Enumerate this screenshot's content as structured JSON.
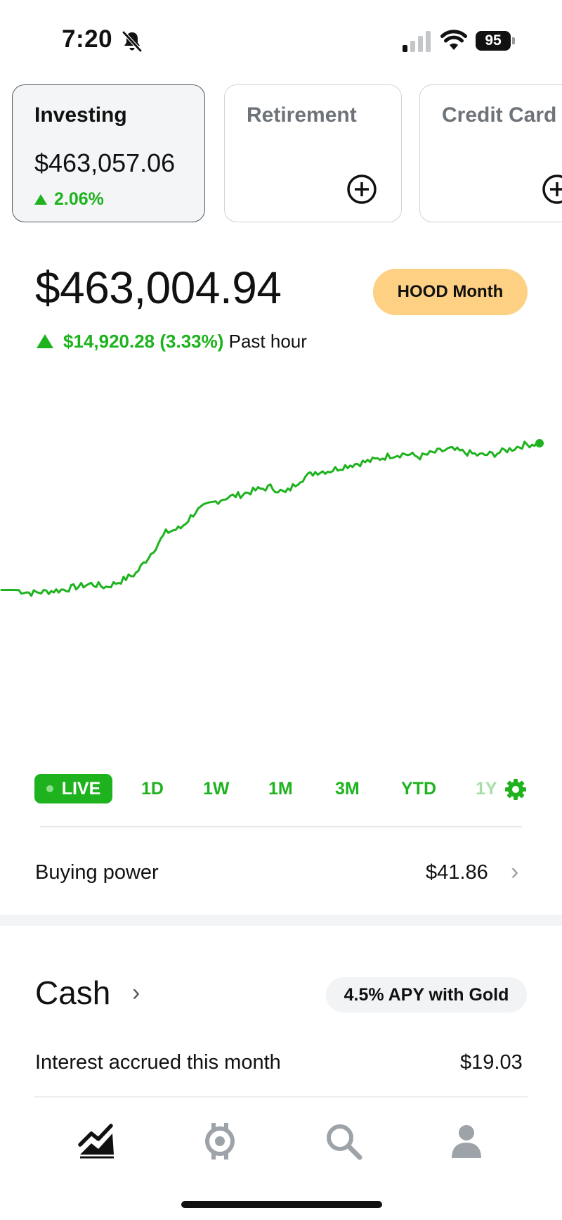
{
  "status_bar": {
    "time": "7:20",
    "battery": "95"
  },
  "accounts": [
    {
      "name": "Investing",
      "value": "$463,057.06",
      "change": "2.06%"
    },
    {
      "name": "Retirement"
    },
    {
      "name": "Credit Card"
    }
  ],
  "portfolio": {
    "value": "$463,004.94",
    "change_amount": "$14,920.28 (3.33%)",
    "change_period": "Past hour",
    "promo_label": "HOOD Month"
  },
  "chart_data": {
    "type": "line",
    "x_axis": "time (past hour)",
    "series": [
      {
        "values": [
          51.5,
          51.5,
          50.5,
          51,
          51.5,
          52.5,
          53.5,
          52.5,
          54.5,
          57,
          63.5,
          70.5,
          72,
          77.5,
          80,
          82,
          83,
          84.5,
          85.5,
          83.5,
          88,
          90.5,
          91,
          92.5,
          93.5,
          94.5,
          96,
          96.5,
          95.5,
          97,
          98,
          97,
          96,
          96.5,
          98,
          99.5,
          100
        ]
      }
    ],
    "color": "#1eb31e",
    "grid": false
  },
  "ranges": [
    "LIVE",
    "1D",
    "1W",
    "1M",
    "3M",
    "YTD",
    "1Y"
  ],
  "selected_range": "LIVE",
  "buying_power": {
    "label": "Buying power",
    "value": "$41.86"
  },
  "cash": {
    "title": "Cash",
    "badge": "4.5% APY with Gold",
    "interest_label": "Interest accrued this month",
    "interest_value": "$19.03"
  },
  "tab_bar": {
    "icons": [
      "investing-chart-icon",
      "crypto-icon",
      "search-icon",
      "account-icon"
    ]
  }
}
